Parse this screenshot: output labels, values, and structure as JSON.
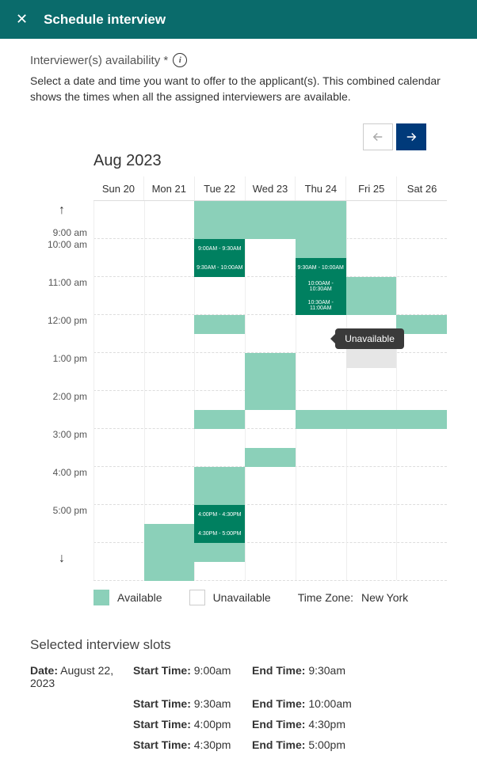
{
  "header": {
    "title": "Schedule interview"
  },
  "availability": {
    "label": "Interviewer(s) availability *",
    "description": "Select a date and time you want to offer to the applicant(s). This combined calendar shows the times when all the assigned interviewers are available."
  },
  "calendar": {
    "month": "Aug 2023",
    "days": [
      "Sun 20",
      "Mon 21",
      "Tue 22",
      "Wed 23",
      "Thu 24",
      "Fri 25",
      "Sat 26"
    ],
    "hours": [
      "9:00 am",
      "10:00 am",
      "11:00 am",
      "12:00 pm",
      "1:00 pm",
      "2:00 pm",
      "3:00 pm",
      "4:00 pm",
      "5:00 pm"
    ],
    "tooltip": "Unavailable",
    "selected_slots": [
      {
        "day": 2,
        "label": "9:00AM - 9:30AM"
      },
      {
        "day": 2,
        "label": "9:30AM - 10:00AM"
      },
      {
        "day": 4,
        "label": "9:30AM - 10:00AM"
      },
      {
        "day": 4,
        "label": "10:00AM - 10:30AM"
      },
      {
        "day": 4,
        "label": "10:30AM - 11:00AM"
      },
      {
        "day": 2,
        "label": "4:00PM - 4:30PM"
      },
      {
        "day": 2,
        "label": "4:30PM - 5:00PM"
      }
    ]
  },
  "legend": {
    "available": "Available",
    "unavailable": "Unavailable",
    "timezone_label": "Time Zone:",
    "timezone_value": "New York"
  },
  "selected": {
    "title": "Selected interview slots",
    "date_label": "Date:",
    "date_value": "August 22, 2023",
    "start_label": "Start Time:",
    "end_label": "End Time:",
    "rows": [
      {
        "start": "9:00am",
        "end": "9:30am"
      },
      {
        "start": "9:30am",
        "end": "10:00am"
      },
      {
        "start": "4:00pm",
        "end": "4:30pm"
      },
      {
        "start": "4:30pm",
        "end": "5:00pm"
      }
    ]
  }
}
